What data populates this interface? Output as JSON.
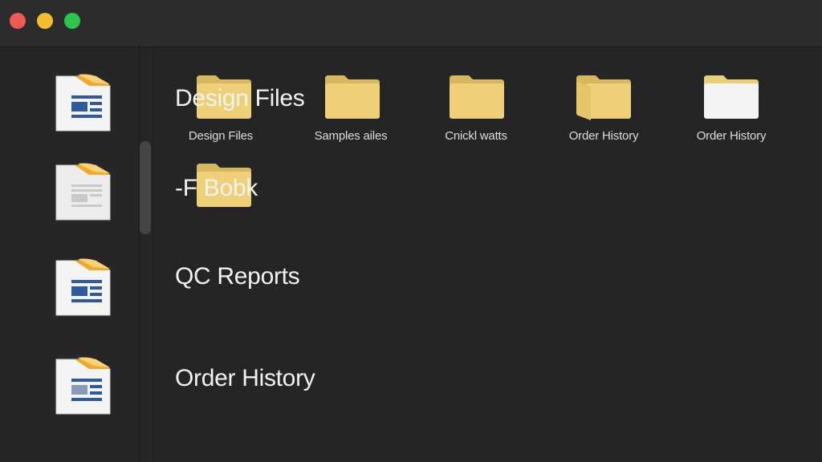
{
  "window": {
    "traffic_lights": [
      "close",
      "minimize",
      "zoom"
    ],
    "colors": {
      "close": "#ed5a56",
      "minimize": "#f2bd2e",
      "zoom": "#2bc64a"
    }
  },
  "sidebar": {
    "items": [
      {
        "icon": "document-icon",
        "style": "blue"
      },
      {
        "icon": "document-icon",
        "style": "gray"
      },
      {
        "icon": "document-icon",
        "style": "blue"
      },
      {
        "icon": "document-icon",
        "style": "blue-gray"
      }
    ]
  },
  "main": {
    "folders": [
      {
        "label": "Design Files",
        "icon": "folder-icon"
      },
      {
        "label": "Samples ailes",
        "icon": "folder-icon"
      },
      {
        "label": "Cnickl watts",
        "icon": "folder-icon"
      },
      {
        "label": "Order History",
        "icon": "folder-open-icon"
      },
      {
        "label": "Order History",
        "icon": "folder-white-icon"
      }
    ],
    "groups": [
      {
        "label": "Design Files"
      },
      {
        "label": "-F Bobk"
      },
      {
        "label": "QC Reports"
      },
      {
        "label": "Order History"
      }
    ]
  },
  "colors": {
    "background": "#252525",
    "titlebar": "#2c2c2c",
    "folder": "#edd077",
    "doc_accent": "#f0a92a",
    "doc_blue": "#2f5a9e"
  }
}
